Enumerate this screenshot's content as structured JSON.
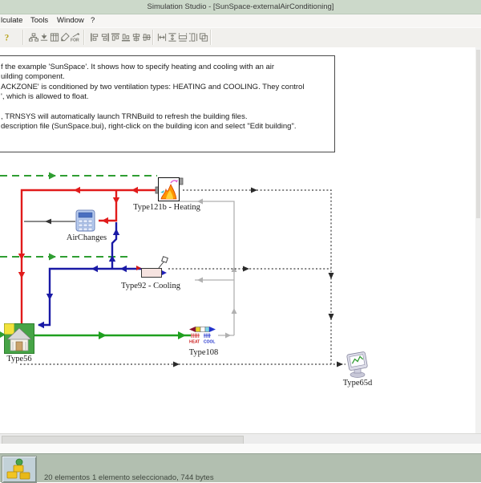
{
  "window": {
    "title": "Simulation Studio - [SunSpace-externalAirConditioning]"
  },
  "menu_bar": {
    "items": [
      "lculate",
      "Tools",
      "Window",
      "?"
    ]
  },
  "toolbar": {
    "groups": [
      [
        "help-key"
      ],
      [
        "hierarchy",
        "direct-access",
        "columns",
        "brush",
        "for-loop"
      ],
      [
        "align-left",
        "align-right",
        "align-top",
        "align-bottom",
        "align-center-h",
        "align-center-v"
      ],
      [
        "space-horizontal",
        "space-vertical",
        "same-width",
        "same-height",
        "same-size"
      ]
    ]
  },
  "description_box": {
    "lines": [
      "f the example 'SunSpace'.  It shows how to specify heating and cooling with an air",
      "uilding component.",
      "ACKZONE' is conditioned by two ventilation types: HEATING and COOLING.  They control",
      "', which is allowed to float.",
      "",
      ", TRNSYS will automatically launch TRNBuild to refresh the building files.",
      "description file (SunSpace.bui), right-click on the building icon and select \"Edit building\"."
    ]
  },
  "components": [
    {
      "label": "Type121b - Heating"
    },
    {
      "label": "AirChanges"
    },
    {
      "label": "Type92 - Cooling"
    },
    {
      "label": "Type56"
    },
    {
      "label": "Type108",
      "heat_label": "HEAT",
      "cool_label": "COOL"
    },
    {
      "label": "Type65d"
    }
  ],
  "status_bar": {
    "elements": "20 elementos",
    "selection": "1 elemento seleccionado, 744 bytes"
  },
  "colors": {
    "title_bar": "#ccd9ca",
    "status_bar": "#b2bfb0",
    "link_red": "#e11b1b",
    "link_blue": "#1a1aa6",
    "link_green_solid": "#1fa01f",
    "link_green_dashed": "#2f9e32",
    "link_control_gray": "#b0b0b0",
    "link_printer_dotted": "#3a3a3a"
  }
}
